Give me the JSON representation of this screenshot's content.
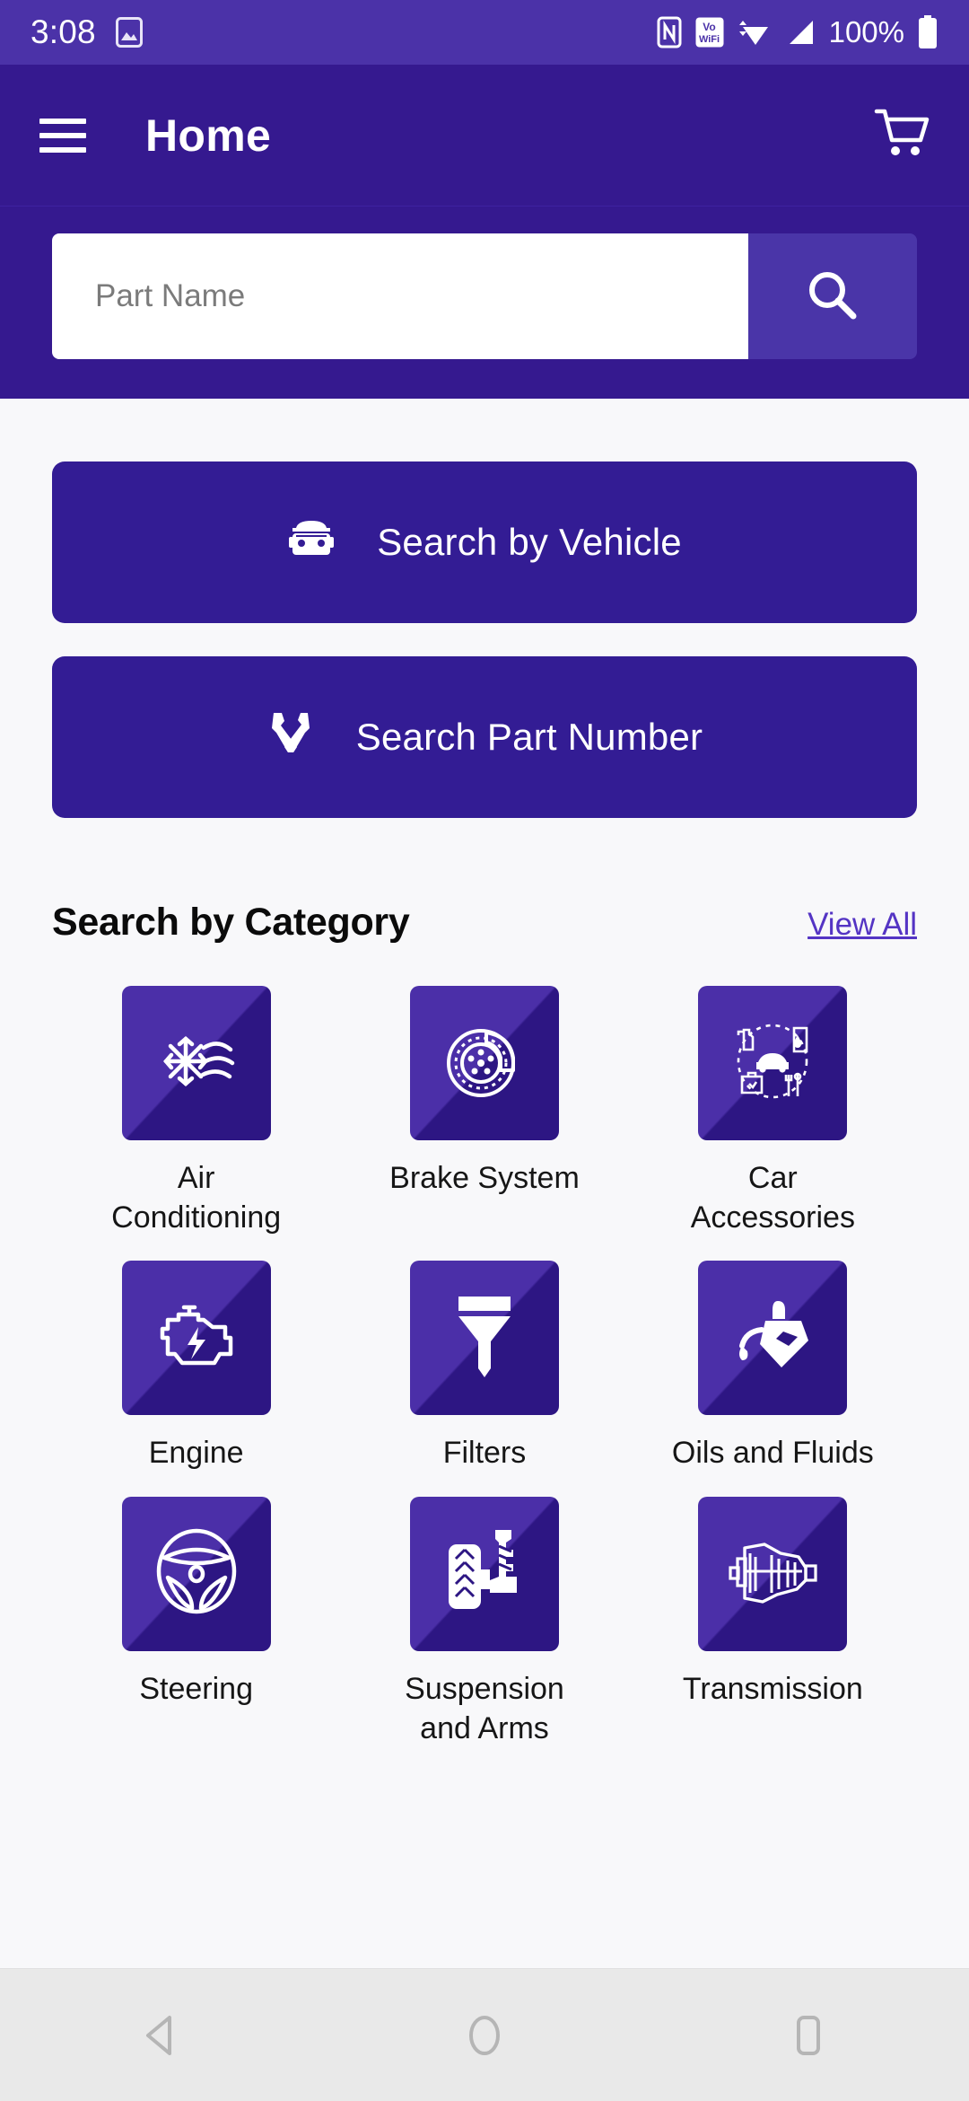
{
  "status_bar": {
    "time": "3:08",
    "battery_percent": "100%",
    "icons": [
      "image-icon",
      "nfc-icon",
      "volte-wifi-icon",
      "wifi-icon",
      "cellular-signal-icon",
      "battery-icon"
    ]
  },
  "app_bar": {
    "title": "Home",
    "menu_icon": "hamburger-menu-icon",
    "cart_icon": "shopping-cart-icon"
  },
  "search": {
    "placeholder": "Part Name",
    "value": "",
    "button_icon": "search-icon"
  },
  "actions": [
    {
      "label": "Search by Vehicle",
      "icon": "car-front-icon"
    },
    {
      "label": "Search Part Number",
      "icon": "crossed-tools-icon"
    }
  ],
  "categories_section": {
    "title": "Search by Category",
    "view_all": "View All"
  },
  "categories": [
    {
      "label": "Air Conditioning",
      "icon": "snowflake-airflow-icon"
    },
    {
      "label": "Brake System",
      "icon": "brake-disc-icon"
    },
    {
      "label": "Car Accessories",
      "icon": "car-accessories-icon"
    },
    {
      "label": "Engine",
      "icon": "engine-icon"
    },
    {
      "label": "Filters",
      "icon": "funnel-filter-icon"
    },
    {
      "label": "Oils and Fluids",
      "icon": "oil-can-icon"
    },
    {
      "label": "Steering",
      "icon": "steering-wheel-icon"
    },
    {
      "label": "Suspension and Arms",
      "icon": "suspension-strut-icon"
    },
    {
      "label": "Transmission",
      "icon": "transmission-gearbox-icon"
    }
  ],
  "nav_bar": {
    "back": "back-triangle-icon",
    "home": "home-circle-icon",
    "recents": "recents-square-icon"
  },
  "colors": {
    "status_bar": "#4B32A8",
    "app_bar": "#35198F",
    "primary_button": "#331C94",
    "search_button": "#4A35A8",
    "link": "#5434C4",
    "page_background": "#F8F8FA",
    "nav_background": "#E9E9E9"
  }
}
